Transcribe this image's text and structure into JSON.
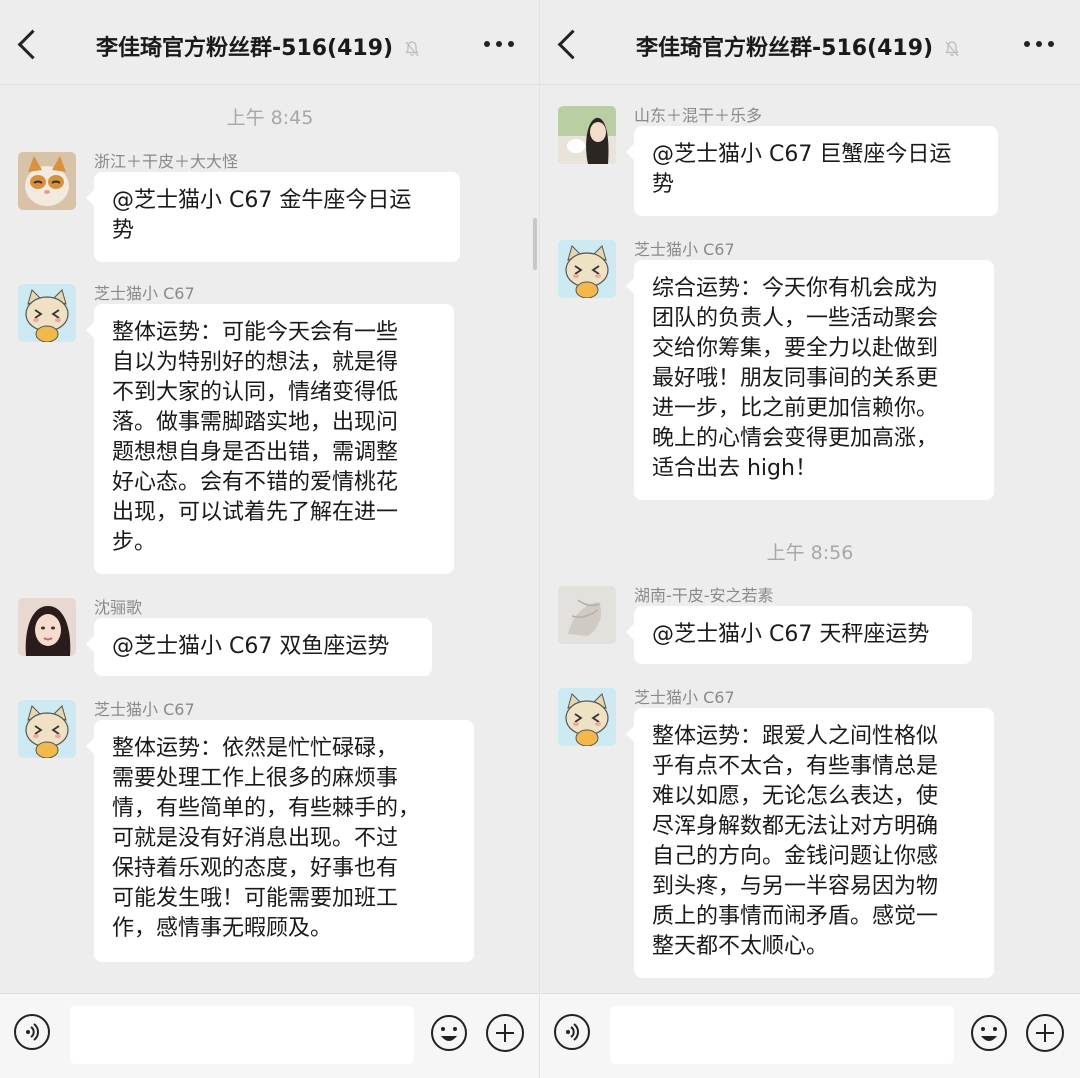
{
  "chat": {
    "title": "李佳琦官方粉丝群-516(419)"
  },
  "colors": {
    "background": "#ededed",
    "bubble": "#ffffff",
    "timestamp": "#a8a8a8",
    "sender": "#8a8a8a"
  },
  "icons": {
    "back": "chevron-left-icon",
    "mute": "bell-off-icon",
    "more": "more-dots-icon",
    "voice": "voice-icon",
    "emoji": "emoji-icon",
    "plus": "plus-icon"
  },
  "left": {
    "time1": "上午 8:45",
    "messages": [
      {
        "sender": "浙江＋干皮＋大大怪",
        "text": "@芝士猫小 C67 金牛座今日运\n势"
      },
      {
        "sender": "芝士猫小 C67",
        "text": "整体运势：可能今天会有一些\n自以为特别好的想法，就是得\n不到大家的认同，情绪变得低\n落。做事需脚踏实地，出现问\n题想想自身是否出错，需调整\n好心态。会有不错的爱情桃花\n出现，可以试着先了解在进一\n步。"
      },
      {
        "sender": "沈骊歌",
        "text": "@芝士猫小 C67 双鱼座运势"
      },
      {
        "sender": "芝士猫小 C67",
        "text": "整体运势：依然是忙忙碌碌，\n需要处理工作上很多的麻烦事\n情，有些简单的，有些棘手的，\n可就是没有好消息出现。不过\n保持着乐观的态度，好事也有\n可能发生哦！可能需要加班工\n作，感情事无暇顾及。"
      }
    ]
  },
  "right": {
    "time2": "上午 8:56",
    "messages": [
      {
        "sender": "山东＋混干＋乐多",
        "text": "@芝士猫小 C67 巨蟹座今日运\n势"
      },
      {
        "sender": "芝士猫小 C67",
        "text": "综合运势：今天你有机会成为\n团队的负责人，一些活动聚会\n交给你筹集，要全力以赴做到\n最好哦！朋友同事间的关系更\n进一步，比之前更加信赖你。\n晚上的心情会变得更加高涨，\n适合出去 high！"
      },
      {
        "sender": "湖南-干皮-安之若素",
        "text": "@芝士猫小 C67 天秤座运势"
      },
      {
        "sender": "芝士猫小 C67",
        "text": "整体运势：跟爱人之间性格似\n乎有点不太合，有些事情总是\n难以如愿，无论怎么表达，使\n尽浑身解数都无法让对方明确\n自己的方向。金钱问题让你感\n到头疼，与另一半容易因为物\n质上的事情而闹矛盾。感觉一\n整天都不太顺心。"
      }
    ]
  }
}
